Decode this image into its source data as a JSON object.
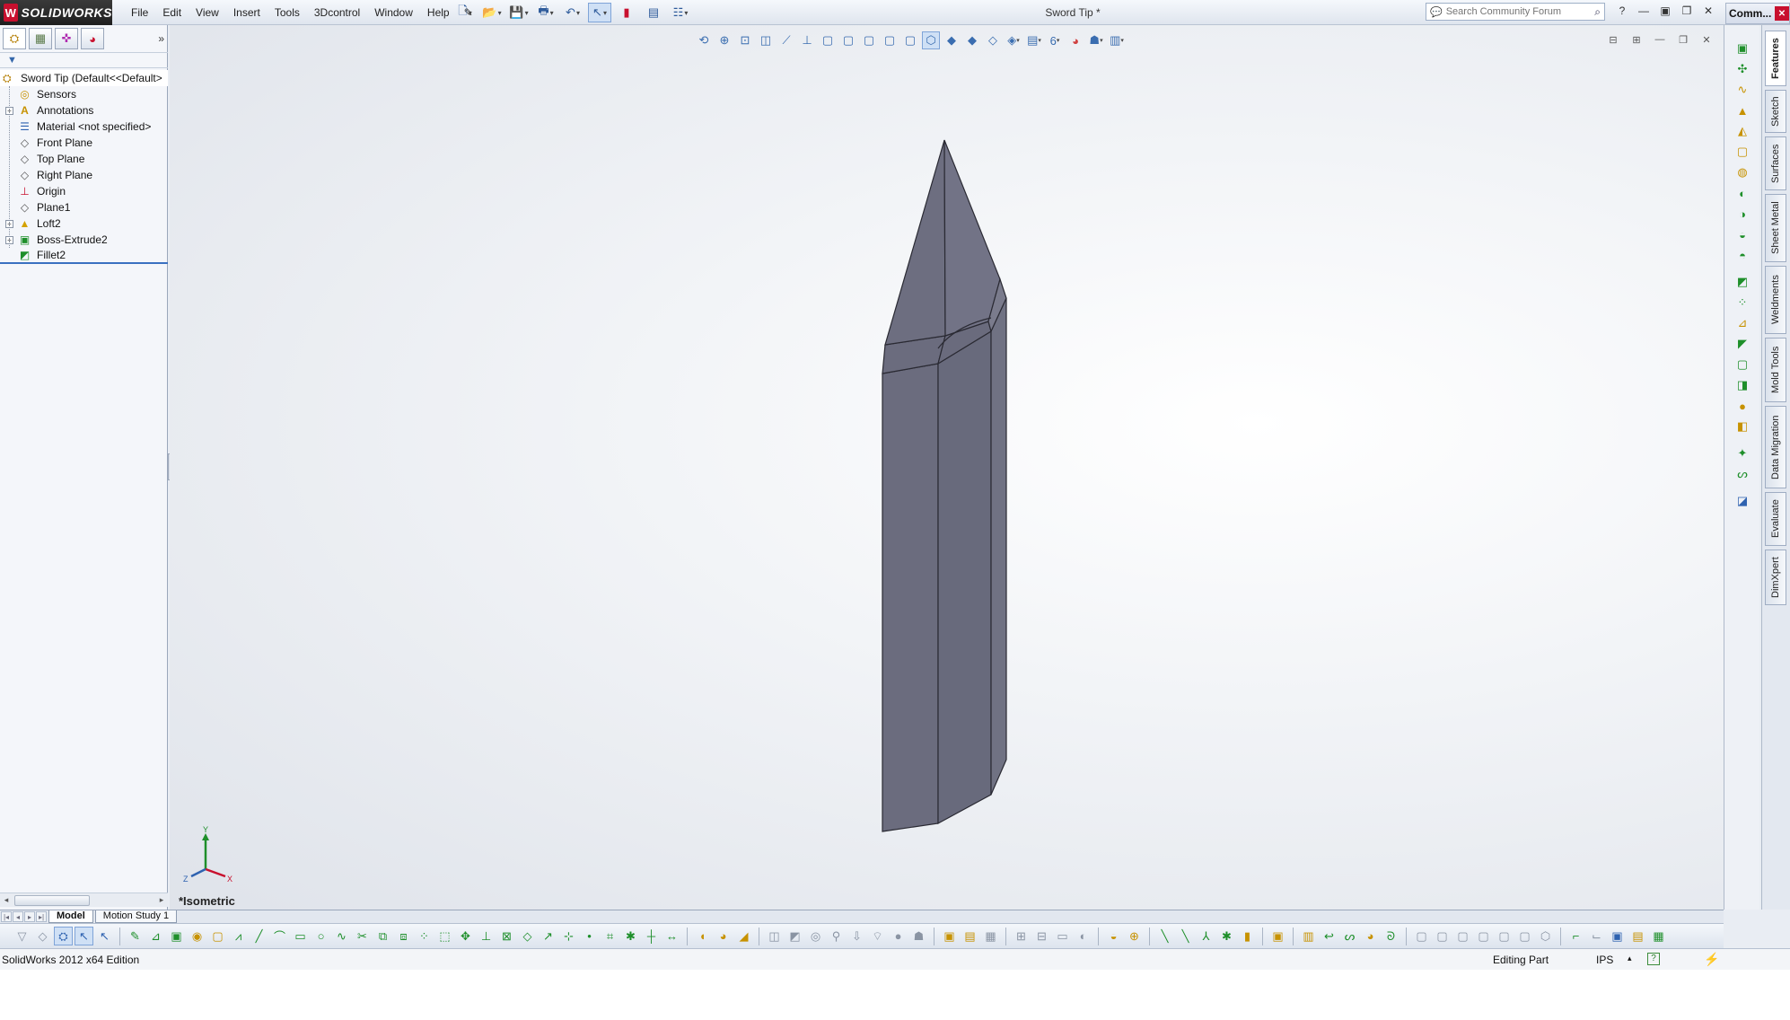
{
  "app": {
    "brand": "SOLIDWORKS",
    "doc_title": "Sword Tip *",
    "menu": [
      "File",
      "Edit",
      "View",
      "Insert",
      "Tools",
      "3Dcontrol",
      "Window",
      "Help"
    ],
    "search_placeholder": "Search Community Forum",
    "task_pane_title": "Comm..."
  },
  "feature_tree": {
    "root": "Sword Tip  (Default<<Default>",
    "items": [
      {
        "label": "Sensors",
        "icon": "sensor-icon",
        "expandable": false
      },
      {
        "label": "Annotations",
        "icon": "annotations-icon",
        "expandable": true
      },
      {
        "label": "Material <not specified>",
        "icon": "material-icon",
        "expandable": false
      },
      {
        "label": "Front Plane",
        "icon": "plane-icon",
        "expandable": false
      },
      {
        "label": "Top Plane",
        "icon": "plane-icon",
        "expandable": false
      },
      {
        "label": "Right Plane",
        "icon": "plane-icon",
        "expandable": false
      },
      {
        "label": "Origin",
        "icon": "origin-icon",
        "expandable": false
      },
      {
        "label": "Plane1",
        "icon": "plane-icon",
        "expandable": false
      },
      {
        "label": "Loft2",
        "icon": "loft-icon",
        "expandable": true
      },
      {
        "label": "Boss-Extrude2",
        "icon": "extrude-icon",
        "expandable": true
      },
      {
        "label": "Fillet2",
        "icon": "fillet-icon",
        "expandable": false
      }
    ]
  },
  "viewport": {
    "view_name": "*Isometric",
    "triad": {
      "x": "X",
      "y": "Y",
      "z": "Z"
    },
    "model_color": "#6b6c7e"
  },
  "command_tabs": [
    "Features",
    "Sketch",
    "Surfaces",
    "Sheet Metal",
    "Weldments",
    "Mold Tools",
    "Data Migration",
    "Evaluate",
    "DimXpert"
  ],
  "bottom_tabs": [
    "Model",
    "Motion Study 1"
  ],
  "status": {
    "edition": "SolidWorks 2012 x64 Edition",
    "mode": "Editing Part",
    "units": "IPS"
  },
  "colors": {
    "accent": "#3a70c0",
    "brand_red": "#c8102e",
    "feature_green": "#1e8f2a"
  }
}
